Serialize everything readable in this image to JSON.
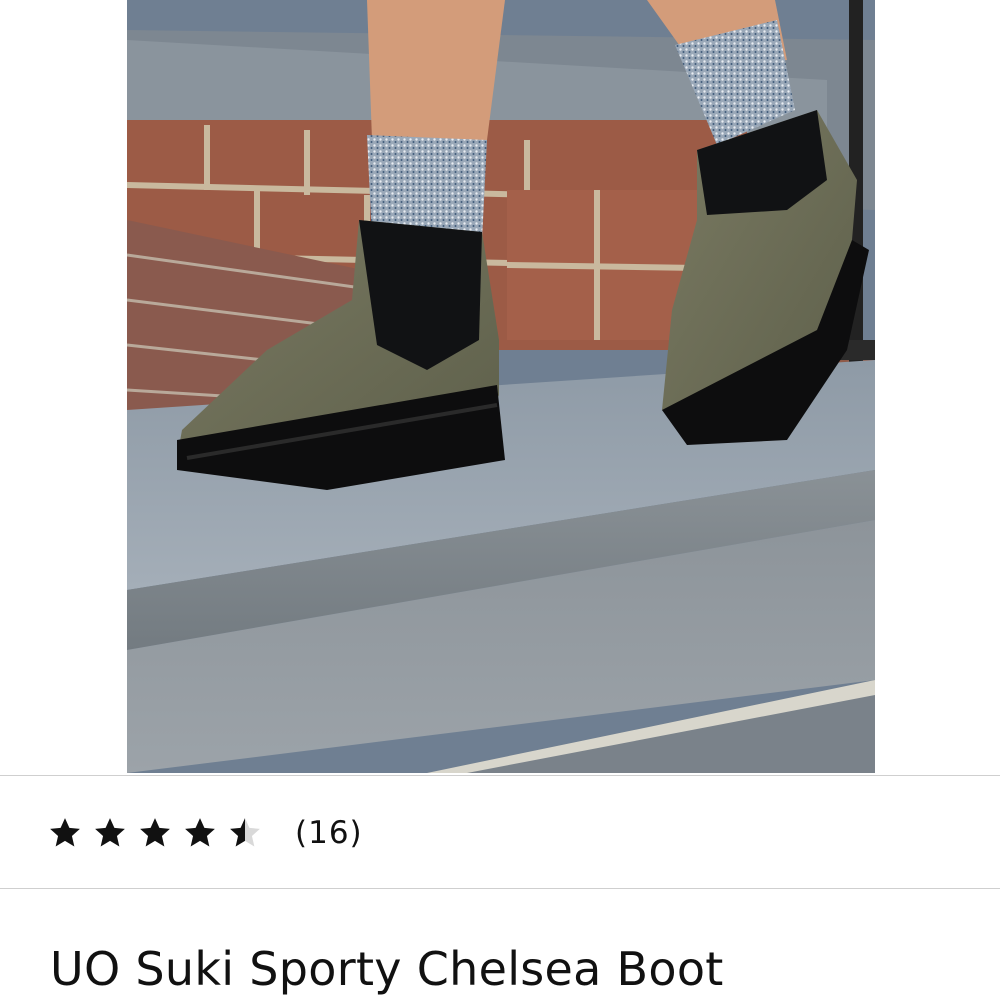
{
  "product": {
    "image_alt": "Olive green sporty chelsea boots worn with speckled socks on stone steps",
    "rating": {
      "value": 4.5,
      "max": 5,
      "count_label": "(16)"
    },
    "title": "UO Suki Sporty Chelsea Boot"
  },
  "colors": {
    "star_fill": "#111111",
    "star_empty": "#d9d9d9",
    "divider": "#cfcfcf",
    "text": "#111111"
  },
  "icons": {
    "star": "star-icon"
  }
}
